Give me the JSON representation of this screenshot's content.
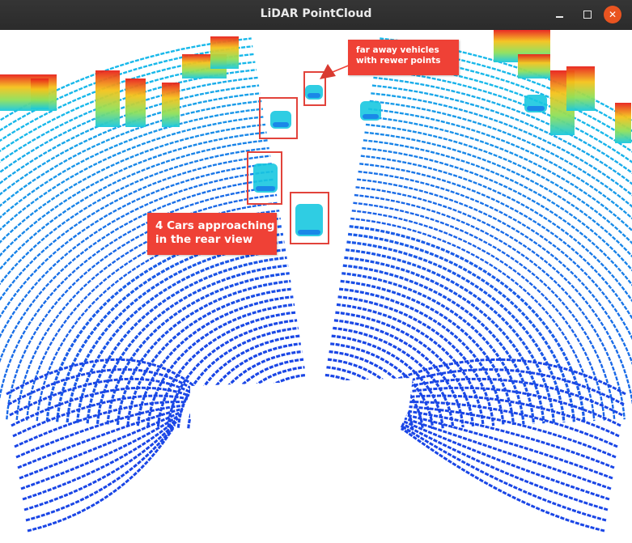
{
  "window": {
    "title": "LiDAR PointCloud",
    "buttons": {
      "minimize": "—",
      "maximize": "□",
      "close": "✕"
    }
  },
  "annotations": {
    "far_vehicles": "far away vehicles with rewer points",
    "cars_rear": "4 Cars approaching in the rear view"
  },
  "colors": {
    "titlebar": "#2c2c2c",
    "close_button": "#e95420",
    "annotation": "#ef4136",
    "ground_near": "#1a4fe0",
    "ground_far": "#0fc3e6",
    "object_high": "#e8201a"
  },
  "icons": [
    "minimize-icon",
    "maximize-icon",
    "close-icon",
    "arrow-icon"
  ]
}
